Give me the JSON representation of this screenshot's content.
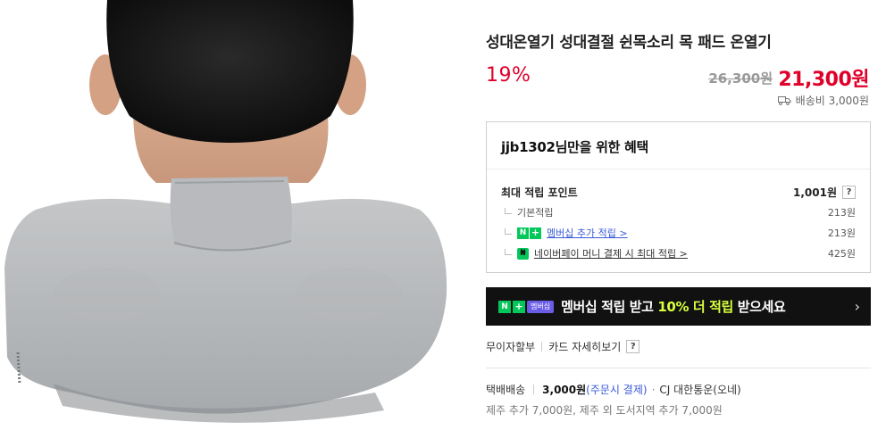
{
  "product": {
    "title": "성대온열기 성대결절 쉰목소리 목 패드 온열기",
    "discount_rate": "19%",
    "original_price": "26,300원",
    "sale_price": "21,300원",
    "shipping_fee": "배송비 3,000원"
  },
  "benefit": {
    "heading": "jjb1302님만을 위한 혜택",
    "max_points_label": "최대 적립 포인트",
    "max_points_value": "1,001원",
    "help_glyph": "?",
    "rows": [
      {
        "label": "기본적립",
        "value": "213원"
      },
      {
        "badge_n": "N",
        "badge_plus": "+",
        "label": "멤버십 추가 적립 >",
        "value": "213원"
      },
      {
        "badge_pay": "₦",
        "label": "네이버페이 머니 결제 시 최대 적립 >",
        "value": "425원"
      }
    ]
  },
  "banner": {
    "badge_n": "N",
    "badge_plus": "+",
    "badge_membership": "멤버십",
    "text_before": "멤버십 적립 받고 ",
    "text_highlight": "10% 더 적립",
    "text_after": " 받으세요",
    "chevron": "›"
  },
  "card": {
    "installment": "무이자할부",
    "card_details": "카드 자세히보기",
    "help_glyph": "?"
  },
  "delivery": {
    "method": "택배배송",
    "fee": "3,000원",
    "condition": "(주문시 결제)",
    "dot": "·",
    "courier": "CJ 대한통운(오네)",
    "extra": "제주 추가 7,000원, 제주 외 도서지역 추가 7,000원"
  },
  "icons": {
    "truck": "truck-icon",
    "help": "question-icon",
    "chevron": "chevron-right-icon"
  },
  "colors": {
    "accent_red": "#e0002a",
    "naver_green": "#03c75a",
    "link_blue": "#3b5bd6",
    "banner_bg": "#111111",
    "banner_highlight": "#d9ff3f"
  }
}
